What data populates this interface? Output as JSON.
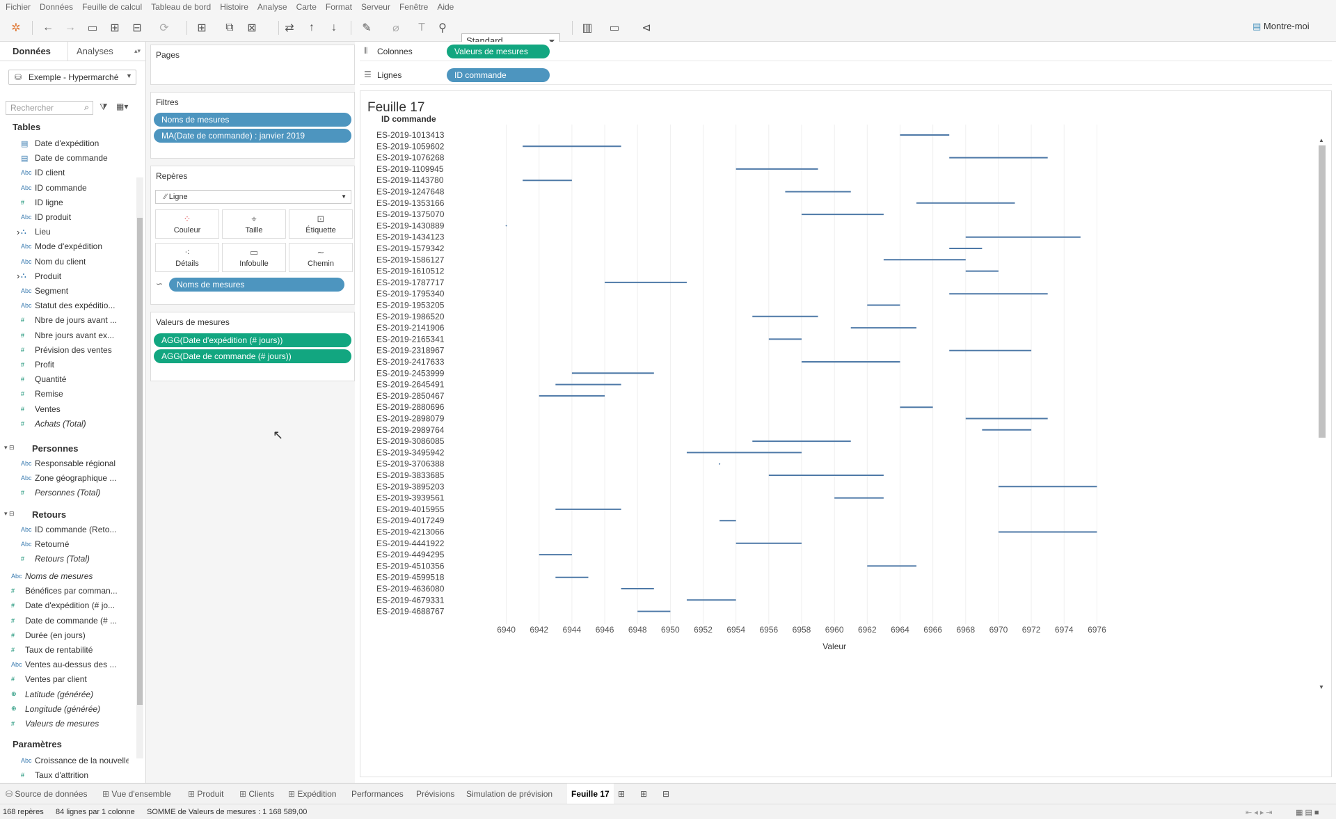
{
  "menu": [
    "Fichier",
    "Données",
    "Feuille de calcul",
    "Tableau de bord",
    "Histoire",
    "Analyse",
    "Carte",
    "Format",
    "Serveur",
    "Fenêtre",
    "Aide"
  ],
  "toolbar": {
    "standard": "Standard",
    "show_me": "Montre-moi"
  },
  "data_pane": {
    "tab_data": "Données",
    "tab_analytics": "Analyses",
    "source": "Exemple - Hypermarché",
    "search_placeholder": "Rechercher",
    "tables_title": "Tables",
    "fields": [
      {
        "t": "cal",
        "label": "Date d'expédition"
      },
      {
        "t": "cal",
        "label": "Date de commande"
      },
      {
        "t": "abc",
        "label": "ID client"
      },
      {
        "t": "abc",
        "label": "ID commande"
      },
      {
        "t": "num",
        "label": "ID ligne"
      },
      {
        "t": "abc",
        "label": "ID produit"
      },
      {
        "t": "geo",
        "label": "Lieu"
      },
      {
        "t": "abc",
        "label": "Mode d'expédition"
      },
      {
        "t": "abc",
        "label": "Nom du client"
      },
      {
        "t": "geo",
        "label": "Produit"
      },
      {
        "t": "abc",
        "label": "Segment"
      },
      {
        "t": "abc",
        "label": "Statut des expéditio..."
      },
      {
        "t": "num",
        "label": "Nbre de jours avant ..."
      },
      {
        "t": "num",
        "label": "Nbre jours avant ex..."
      },
      {
        "t": "num",
        "label": "Prévision des ventes"
      },
      {
        "t": "num",
        "label": "Profit"
      },
      {
        "t": "num",
        "label": "Quantité"
      },
      {
        "t": "num",
        "label": "Remise"
      },
      {
        "t": "num",
        "label": "Ventes"
      },
      {
        "t": "num",
        "label": "Achats (Total)",
        "it": true
      }
    ],
    "personnes_title": "Personnes",
    "personnes_fields": [
      {
        "t": "abc",
        "label": "Responsable régional"
      },
      {
        "t": "abc",
        "label": "Zone géographique ..."
      },
      {
        "t": "num",
        "label": "Personnes (Total)",
        "it": true
      }
    ],
    "retours_title": "Retours",
    "retours_fields": [
      {
        "t": "abc",
        "label": "ID commande (Reto..."
      },
      {
        "t": "abc",
        "label": "Retourné"
      },
      {
        "t": "num",
        "label": "Retours (Total)",
        "it": true
      }
    ],
    "measure_fields": [
      {
        "t": "abc",
        "label": "Noms de mesures",
        "it": true
      },
      {
        "t": "num",
        "label": "Bénéfices par comman..."
      },
      {
        "t": "num",
        "label": "Date d'expédition (# jo..."
      },
      {
        "t": "num",
        "label": "Date de commande (# ..."
      },
      {
        "t": "num",
        "label": "Durée (en jours)"
      },
      {
        "t": "num",
        "label": "Taux de rentabilité"
      },
      {
        "t": "abc",
        "label": "Ventes au-dessus des ..."
      },
      {
        "t": "num",
        "label": "Ventes par client"
      },
      {
        "t": "globe",
        "label": "Latitude (générée)",
        "it": true
      },
      {
        "t": "globe",
        "label": "Longitude (générée)",
        "it": true
      },
      {
        "t": "num",
        "label": "Valeurs de mesures",
        "it": true
      }
    ],
    "params_title": "Paramètres",
    "params": [
      {
        "t": "abc",
        "label": "Croissance de la nouvelle ..."
      },
      {
        "t": "num",
        "label": "Taux d'attrition"
      }
    ]
  },
  "cards": {
    "pages_title": "Pages",
    "filters_title": "Filtres",
    "filters": [
      "Noms de mesures",
      "MA(Date de commande) : janvier 2019"
    ],
    "marks_title": "Repères",
    "mark_type": "Ligne",
    "mark_buttons": [
      "Couleur",
      "Taille",
      "Étiquette",
      "Détails",
      "Infobulle",
      "Chemin"
    ],
    "marks_pill": "Noms de mesures",
    "measure_values_title": "Valeurs de mesures",
    "measure_values": [
      "AGG(Date d'expédition (# jours))",
      "AGG(Date de commande (# jours))"
    ]
  },
  "shelves": {
    "columns_label": "Colonnes",
    "columns_pill": "Valeurs de mesures",
    "rows_label": "Lignes",
    "rows_pill": "ID commande"
  },
  "sheet": {
    "title": "Feuille 17"
  },
  "chart_data": {
    "type": "gantt",
    "row_header": "ID commande",
    "xlabel": "Valeur",
    "xlim": [
      6939,
      6977
    ],
    "xticks": [
      6940,
      6942,
      6944,
      6946,
      6948,
      6950,
      6952,
      6954,
      6956,
      6958,
      6960,
      6962,
      6964,
      6966,
      6968,
      6970,
      6972,
      6974,
      6976
    ],
    "line_color": "#4e79a7",
    "rows": [
      {
        "id": "ES-2019-1013413",
        "start": 6964,
        "end": 6967
      },
      {
        "id": "ES-2019-1059602",
        "start": 6941,
        "end": 6947
      },
      {
        "id": "ES-2019-1076268",
        "start": 6967,
        "end": 6973
      },
      {
        "id": "ES-2019-1109945",
        "start": 6954,
        "end": 6959
      },
      {
        "id": "ES-2019-1143780",
        "start": 6941,
        "end": 6944
      },
      {
        "id": "ES-2019-1247648",
        "start": 6957,
        "end": 6961
      },
      {
        "id": "ES-2019-1353166",
        "start": 6965,
        "end": 6971
      },
      {
        "id": "ES-2019-1375070",
        "start": 6958,
        "end": 6963
      },
      {
        "id": "ES-2019-1430889",
        "start": 6940,
        "end": 6940
      },
      {
        "id": "ES-2019-1434123",
        "start": 6968,
        "end": 6975
      },
      {
        "id": "ES-2019-1579342",
        "start": 6967,
        "end": 6969
      },
      {
        "id": "ES-2019-1586127",
        "start": 6963,
        "end": 6968
      },
      {
        "id": "ES-2019-1610512",
        "start": 6968,
        "end": 6970
      },
      {
        "id": "ES-2019-1787717",
        "start": 6946,
        "end": 6951
      },
      {
        "id": "ES-2019-1795340",
        "start": 6967,
        "end": 6973
      },
      {
        "id": "ES-2019-1953205",
        "start": 6962,
        "end": 6964
      },
      {
        "id": "ES-2019-1986520",
        "start": 6955,
        "end": 6959
      },
      {
        "id": "ES-2019-2141906",
        "start": 6961,
        "end": 6965
      },
      {
        "id": "ES-2019-2165341",
        "start": 6956,
        "end": 6958
      },
      {
        "id": "ES-2019-2318967",
        "start": 6967,
        "end": 6972
      },
      {
        "id": "ES-2019-2417633",
        "start": 6958,
        "end": 6964
      },
      {
        "id": "ES-2019-2453999",
        "start": 6944,
        "end": 6949
      },
      {
        "id": "ES-2019-2645491",
        "start": 6943,
        "end": 6947
      },
      {
        "id": "ES-2019-2850467",
        "start": 6942,
        "end": 6946
      },
      {
        "id": "ES-2019-2880696",
        "start": 6964,
        "end": 6966
      },
      {
        "id": "ES-2019-2898079",
        "start": 6968,
        "end": 6973
      },
      {
        "id": "ES-2019-2989764",
        "start": 6969,
        "end": 6972
      },
      {
        "id": "ES-2019-3086085",
        "start": 6955,
        "end": 6961
      },
      {
        "id": "ES-2019-3495942",
        "start": 6951,
        "end": 6958
      },
      {
        "id": "ES-2019-3706388",
        "start": 6953,
        "end": 6953
      },
      {
        "id": "ES-2019-3833685",
        "start": 6956,
        "end": 6963
      },
      {
        "id": "ES-2019-3895203",
        "start": 6970,
        "end": 6976
      },
      {
        "id": "ES-2019-3939561",
        "start": 6960,
        "end": 6963
      },
      {
        "id": "ES-2019-4015955",
        "start": 6943,
        "end": 6947
      },
      {
        "id": "ES-2019-4017249",
        "start": 6953,
        "end": 6954
      },
      {
        "id": "ES-2019-4213066",
        "start": 6970,
        "end": 6976
      },
      {
        "id": "ES-2019-4441922",
        "start": 6954,
        "end": 6958
      },
      {
        "id": "ES-2019-4494295",
        "start": 6942,
        "end": 6944
      },
      {
        "id": "ES-2019-4510356",
        "start": 6962,
        "end": 6965
      },
      {
        "id": "ES-2019-4599518",
        "start": 6943,
        "end": 6945
      },
      {
        "id": "ES-2019-4636080",
        "start": 6947,
        "end": 6949
      },
      {
        "id": "ES-2019-4679331",
        "start": 6951,
        "end": 6954
      },
      {
        "id": "ES-2019-4688767",
        "start": 6948,
        "end": 6950
      }
    ]
  },
  "bottom_tabs": [
    "Source de données",
    "Vue d'ensemble",
    "Produit",
    "Clients",
    "Expédition",
    "Performances",
    "Prévisions",
    "Simulation de prévision",
    "Feuille 17"
  ],
  "status": {
    "marks": "168 repères",
    "rows_cols": "84 lignes par 1 colonne",
    "sum": "SOMME de Valeurs de mesures : 1 168 589,00"
  }
}
